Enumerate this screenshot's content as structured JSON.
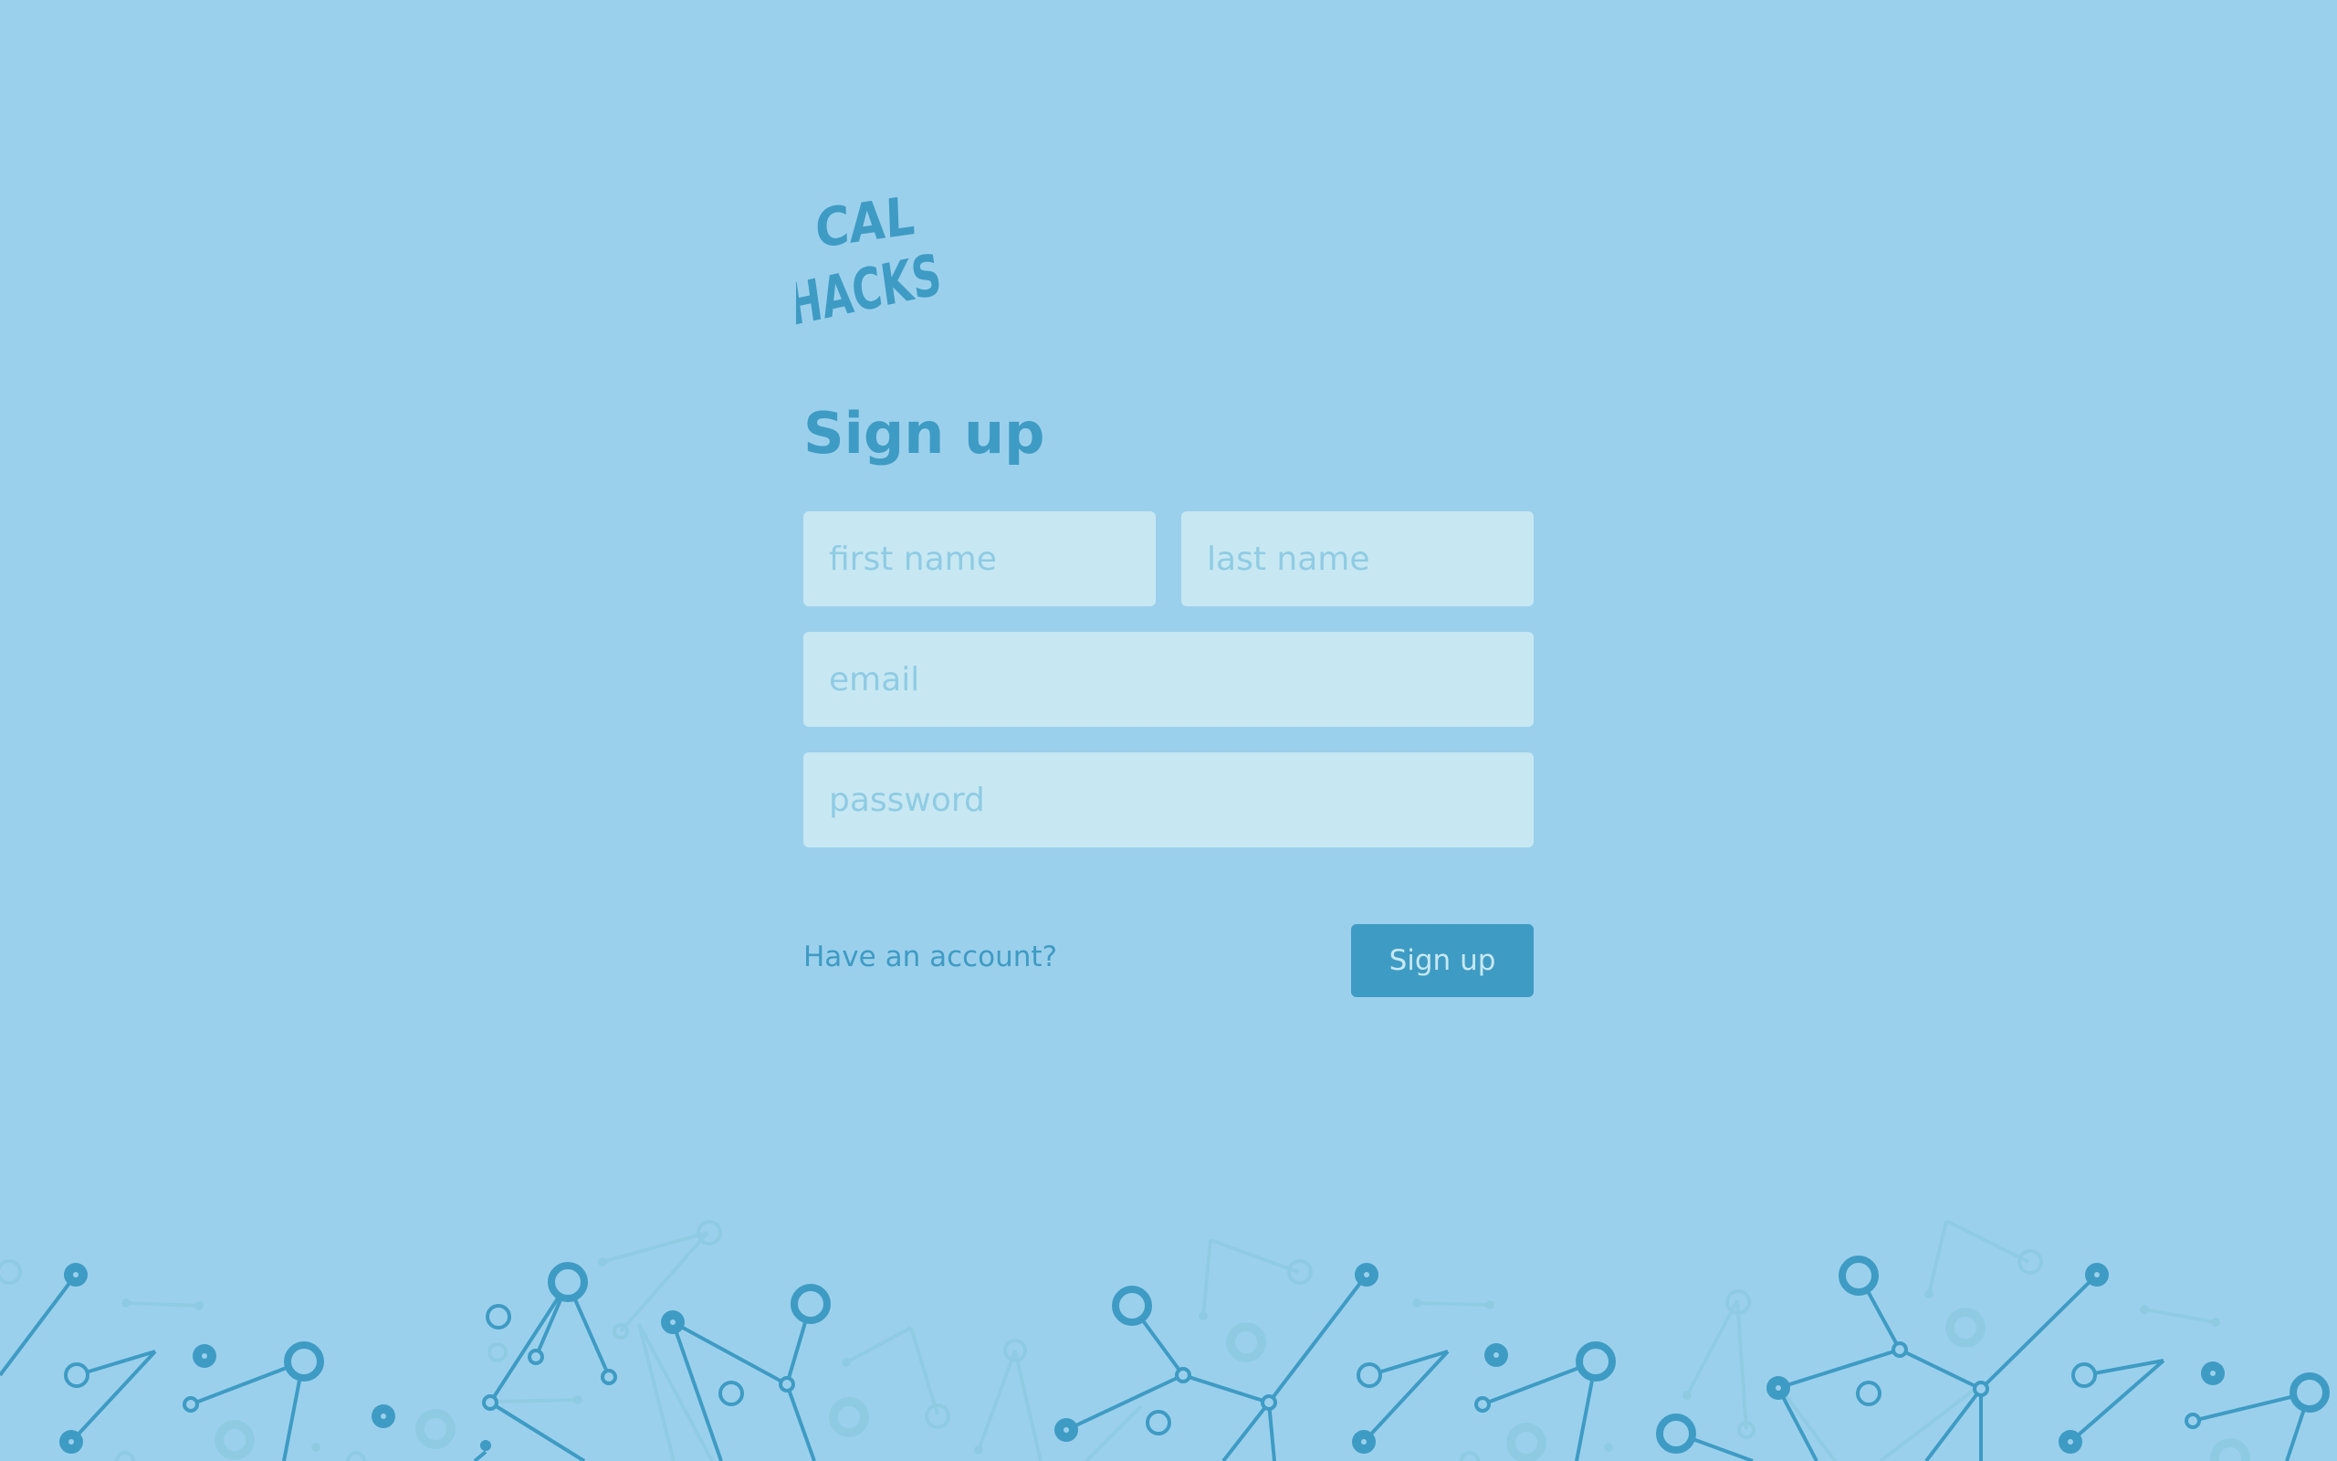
{
  "logo": {
    "line1": "CAL",
    "line2": "HACKS"
  },
  "form": {
    "title": "Sign up",
    "first_name_placeholder": "first name",
    "last_name_placeholder": "last name",
    "email_placeholder": "email",
    "password_placeholder": "password",
    "have_account_label": "Have an account?",
    "submit_label": "Sign up"
  },
  "colors": {
    "background": "#9bd0ec",
    "accent": "#3e9bc4",
    "input_background": "#c7e8f2",
    "placeholder": "#8fcbe4"
  },
  "decoration": {
    "footer_pattern": "network-graph-pattern"
  }
}
